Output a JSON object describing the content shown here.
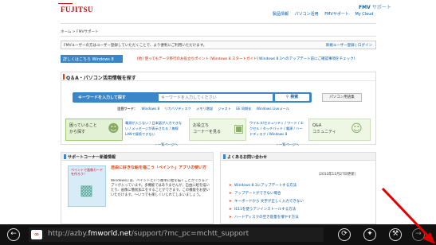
{
  "header": {
    "logo": "FUJITSU",
    "fmv": "FMV",
    "fmv_sub": "サポート",
    "links": [
      "製品情報",
      "パソコン活用",
      "FMVサポート",
      "My Cloud"
    ]
  },
  "breadcrumb": "ホーム > FMVサポート",
  "notice": {
    "text": "FMVユーザーの方はユーザー登録していただくことで、より便利にご利用いただけます。",
    "right": "新規ユーザー登録 | ログイン"
  },
  "banner": {
    "button": "詳しくはこちら Windows 8",
    "link1": "[他] 使ってもデータ移行のお役立ちポイント [Windows 8 スタートガイド]",
    "link2": "Windows 8.1へのアップデート前にご確認事項をチェック！"
  },
  "search_box": {
    "title": "Q＆A・パソコン活用情報を探す",
    "label": "キーワードを入力して探す",
    "placeholder": "キーワードを入力してください",
    "search_btn": "検索",
    "adv_btn": "パソコン用語集",
    "popular_label": "注目ワード：",
    "popular": [
      "Windows 8",
      "リカバリディスク",
      "メモリ増設",
      "ジャスト",
      "EE 同期化",
      "Windows Liveメール"
    ]
  },
  "tiles": [
    {
      "label": "困っていること\nから探す"
    },
    {
      "label": "お役立ち\nコーナーを見る"
    },
    {
      "label": "Q&A\nコミュニティ"
    }
  ],
  "tile_links1": [
    "電源が入らない / 日本語が入力できない / メッセージが表示される / 無線LANで接続できない"
  ],
  "tile_links2": [
    "ウイルス/セキュリティ / ワード / エクセル / タッチパッド / 電源 / ハードディスク / Windows 8"
  ],
  "more1": "一覧ページへ",
  "more2": "一覧ページへ",
  "corner": {
    "title": "サポートコーナー新着情報",
    "img_caption": "ペイントで画像カードを作ろう！",
    "headline": "自由に好きな絵を描こう「ペイント」アプリの使い方",
    "body": "Windowsには、ペイントという簡単に絵を描くことができるアプリが入っています。多機能ではありませんが、自由に絵を描いたり、画像に簡易加工をすることができます。この機能をお使いいただけます。〜いつでも楽しくいじれてしまいましょう。"
  },
  "faq": {
    "title": "よくあるお問い合わせ",
    "date": "（2013年11月27日更新）",
    "items": [
      "Windows 8.1にアップデートする方法",
      "アップデートができない場合",
      "キーボードから 文字が正しく入力できない",
      "IE11を使うアンインストールする方法",
      "ハードディスクの空き容量を増やす方法"
    ]
  },
  "addressbar": {
    "domain_pre": "http://azby.",
    "domain": "fmworld.net",
    "path": "/support/?mc_pc=mchtt_support"
  }
}
